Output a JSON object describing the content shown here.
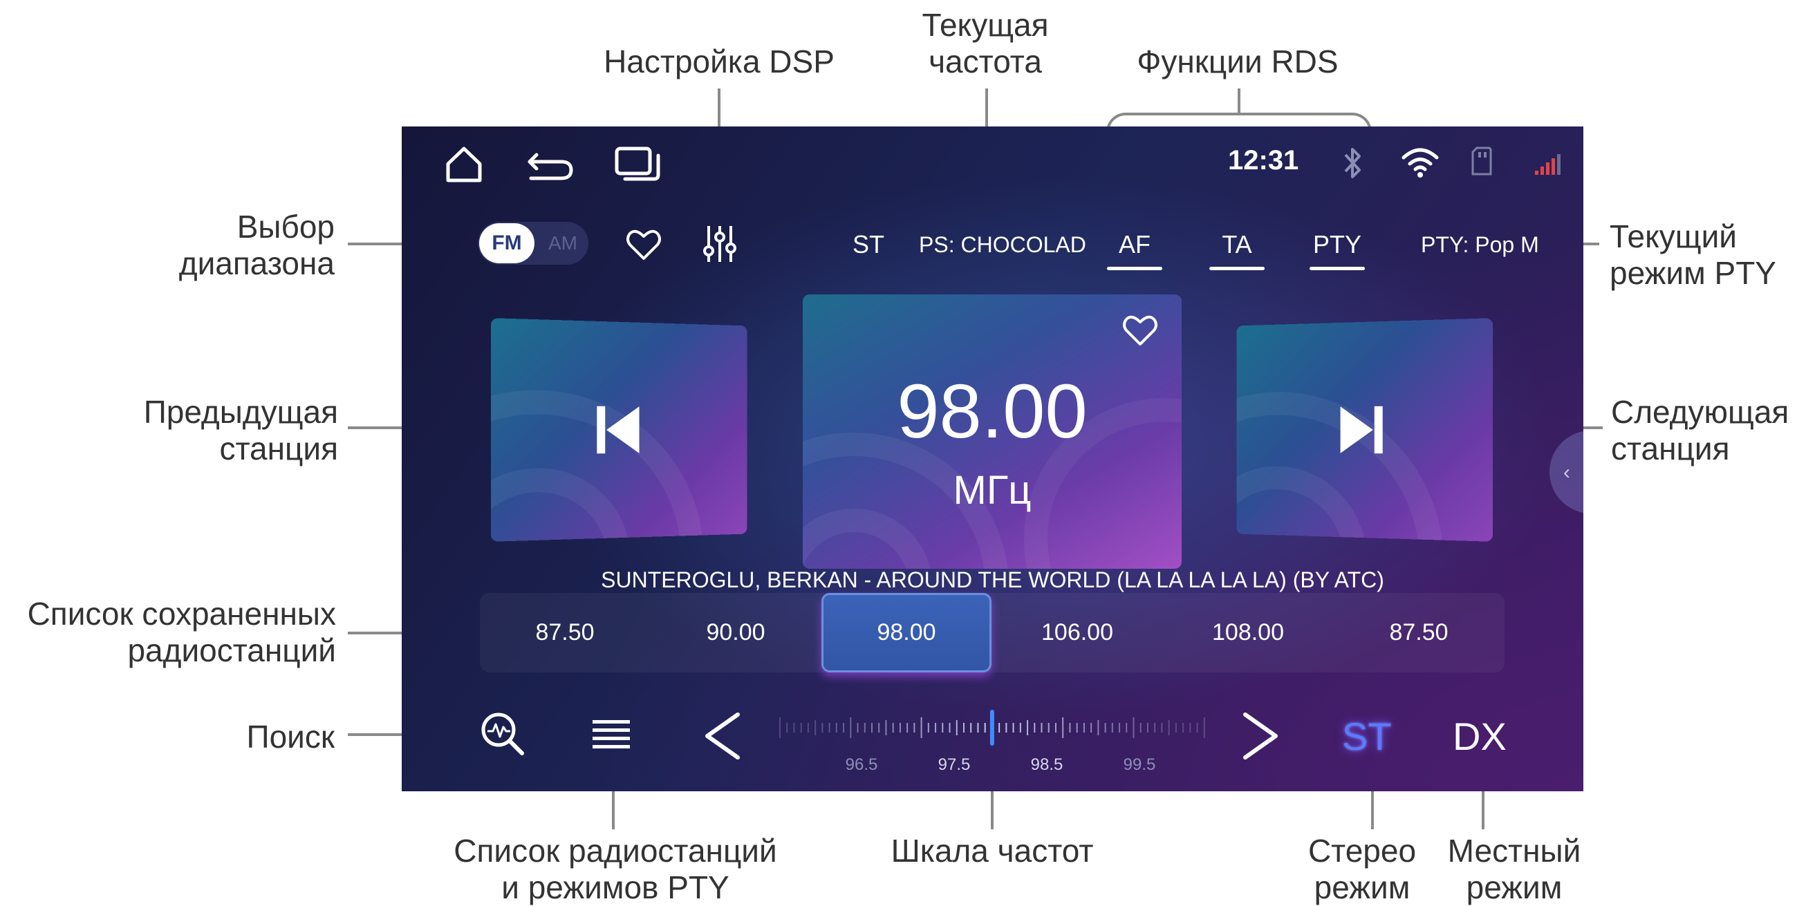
{
  "callouts": {
    "band_select": "Выбор\nдиапазона",
    "dsp_settings": "Настройка DSP",
    "current_frequency": "Текущая\nчастота",
    "rds_functions": "Функции RDS",
    "current_pty": "Текущий\nрежим PTY",
    "prev_station": "Предыдущая\nстанция",
    "next_station": "Следующая\nстанция",
    "saved_list": "Список сохраненных\nрадиостанций",
    "search": "Поиск",
    "station_pty_list": "Список радиостанций\nи режимов PTY",
    "freq_scale": "Шкала частот",
    "stereo_mode": "Стерео\nрежим",
    "local_mode": "Местный\nрежим"
  },
  "status_bar": {
    "time": "12:31",
    "icons": [
      "home-icon",
      "back-icon",
      "recent-apps-icon",
      "bluetooth-icon",
      "wifi-icon",
      "sd-card-icon",
      "signal-icon"
    ]
  },
  "band": {
    "fm": "FM",
    "am": "AM",
    "selected": "FM"
  },
  "rds_bar": {
    "st": "ST",
    "ps": "PS: CHOCOLAD",
    "af": "AF",
    "ta": "TA",
    "pty": "PTY",
    "pty_current": "PTY: Pop M"
  },
  "tuner": {
    "frequency": "98.00",
    "unit": "МГц",
    "now_playing": "SUNTEROGLU, BERKAN - AROUND THE WORLD (LA LA LA LA LA) (BY ATC)"
  },
  "presets": [
    "87.50",
    "90.00",
    "98.00",
    "106.00",
    "108.00",
    "87.50"
  ],
  "active_preset_index": 2,
  "scale": {
    "labels": [
      "96.5",
      "97.5",
      "98.5",
      "99.5"
    ]
  },
  "bottom": {
    "st": "ST",
    "dx": "DX"
  },
  "colors": {
    "accent": "#3f7bff",
    "st_active": "#4f6dff",
    "scale_marker": "#3f8cff"
  }
}
